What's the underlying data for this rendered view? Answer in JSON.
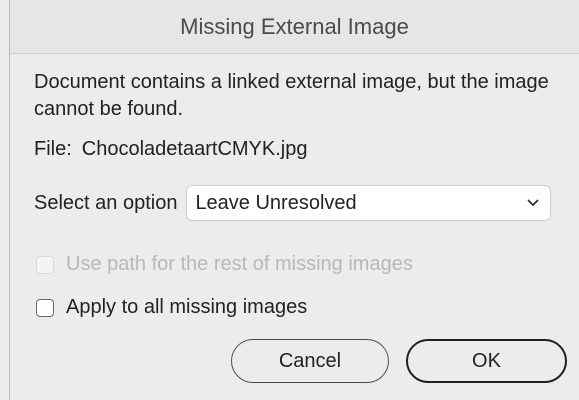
{
  "window": {
    "title": "Missing External Image"
  },
  "message": {
    "text": "Document contains a linked external image, but the image cannot be found."
  },
  "file": {
    "label": "File:",
    "name": "ChocoladetaartCMYK.jpg"
  },
  "option": {
    "label": "Select an option",
    "selected": "Leave Unresolved",
    "icon": "chevron-down-icon"
  },
  "checkboxes": [
    {
      "label": "Use path for the rest of missing images",
      "checked": false,
      "enabled": false
    },
    {
      "label": "Apply to all missing images",
      "checked": false,
      "enabled": true
    }
  ],
  "buttons": {
    "cancel": "Cancel",
    "ok": "OK"
  }
}
